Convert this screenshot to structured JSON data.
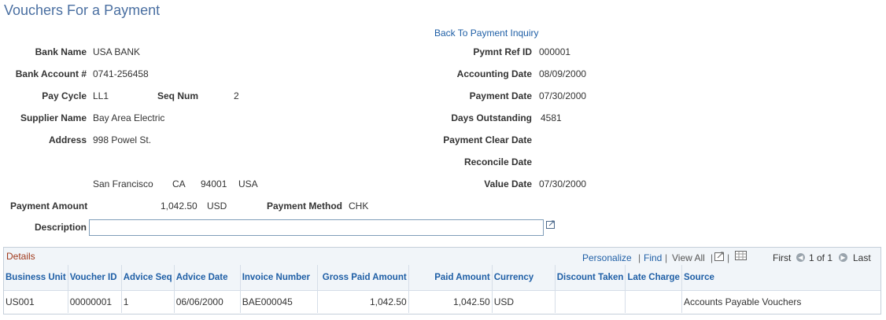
{
  "page": {
    "title": "Vouchers For a Payment",
    "back_link": "Back To Payment Inquiry"
  },
  "left": {
    "bank_name": {
      "label": "Bank Name",
      "value": "USA BANK"
    },
    "bank_account": {
      "label": "Bank Account #",
      "value": "0741-256458"
    },
    "pay_cycle": {
      "label": "Pay Cycle",
      "value": "LL1"
    },
    "seq_num": {
      "label": "Seq Num",
      "value": "2"
    },
    "supplier_name": {
      "label": "Supplier Name",
      "value": "Bay Area Electric"
    },
    "address": {
      "label": "Address",
      "line1": "998 Powel St.",
      "city": "San Francisco",
      "state": "CA",
      "zip": "94001",
      "country": "USA"
    },
    "payment_amount": {
      "label": "Payment Amount",
      "value": "1,042.50",
      "currency": "USD"
    },
    "payment_method": {
      "label": "Payment Method",
      "value": "CHK"
    },
    "description": {
      "label": "Description",
      "value": ""
    }
  },
  "right": {
    "pymnt_ref_id": {
      "label": "Pymnt Ref ID",
      "value": "000001"
    },
    "accounting_date": {
      "label": "Accounting Date",
      "value": "08/09/2000"
    },
    "payment_date": {
      "label": "Payment Date",
      "value": "07/30/2000"
    },
    "days_outstanding": {
      "label": "Days Outstanding",
      "value": "4581"
    },
    "payment_clear_date": {
      "label": "Payment Clear Date",
      "value": ""
    },
    "reconcile_date": {
      "label": "Reconcile Date",
      "value": ""
    },
    "value_date": {
      "label": "Value Date",
      "value": "07/30/2000"
    }
  },
  "grid": {
    "title": "Details",
    "personalize": "Personalize",
    "sep": "|",
    "find": "Find",
    "view_all": "View All",
    "first": "First",
    "range": "1 of 1",
    "last": "Last",
    "columns": [
      "Business Unit",
      "Voucher ID",
      "Advice Seq",
      "Advice Date",
      "Invoice Number",
      "Gross Paid Amount",
      "Paid Amount",
      "Currency",
      "Discount Taken",
      "Late Charge",
      "Source"
    ],
    "rows": [
      [
        "US001",
        "00000001",
        "1",
        "06/06/2000",
        "BAE000045",
        "1,042.50",
        "1,042.50",
        "USD",
        "",
        "",
        "Accounts Payable Vouchers"
      ]
    ]
  },
  "colors": {
    "title": "#4a6fa1",
    "link": "#1f5fa6",
    "grid_title": "#a03a1c",
    "grid_header_bg": "#f1f5f9"
  }
}
